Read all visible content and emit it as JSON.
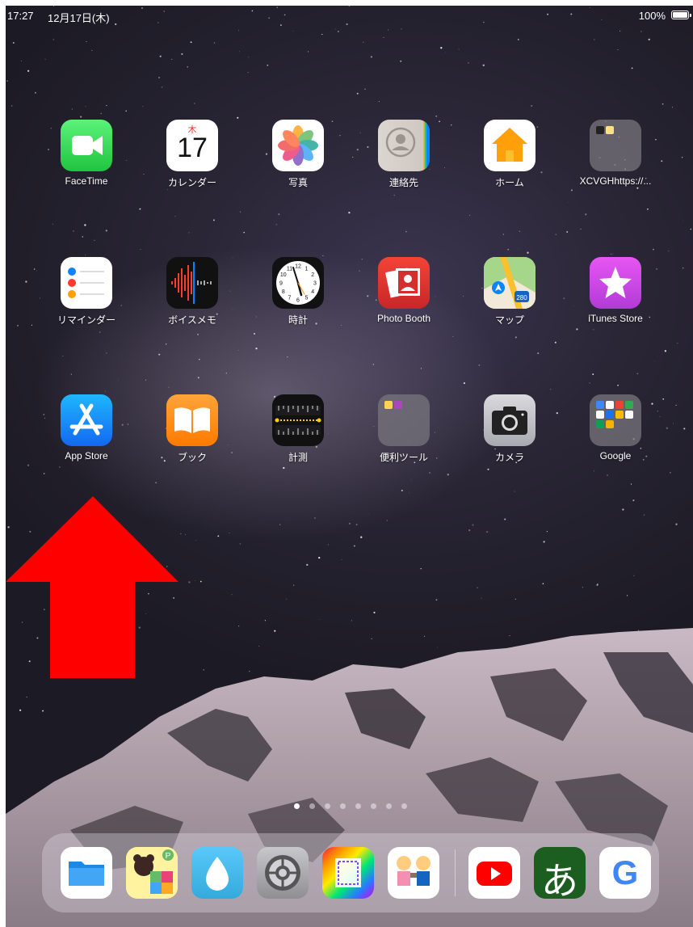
{
  "status_bar": {
    "time": "17:27",
    "date": "12月17日(木)",
    "battery_percent": "100%",
    "battery_level": 1.0
  },
  "apps": [
    {
      "label": "FaceTime",
      "icon": "facetime-icon"
    },
    {
      "label": "カレンダー",
      "icon": "calendar-icon",
      "weekday": "木",
      "day": "17"
    },
    {
      "label": "写真",
      "icon": "photos-icon"
    },
    {
      "label": "連絡先",
      "icon": "contacts-icon"
    },
    {
      "label": "ホーム",
      "icon": "home-app-icon"
    },
    {
      "label": "XCVGHhttps://...",
      "icon": "folder-icon"
    },
    {
      "label": "リマインダー",
      "icon": "reminders-icon"
    },
    {
      "label": "ボイスメモ",
      "icon": "voice-memos-icon"
    },
    {
      "label": "時計",
      "icon": "clock-icon",
      "clock_numbers": [
        "12",
        "1",
        "2",
        "3",
        "4",
        "5",
        "6",
        "7",
        "8",
        "9",
        "10",
        "11"
      ]
    },
    {
      "label": "Photo Booth",
      "icon": "photo-booth-icon"
    },
    {
      "label": "マップ",
      "icon": "maps-icon",
      "road_sign": "280"
    },
    {
      "label": "iTunes Store",
      "icon": "itunes-store-icon"
    },
    {
      "label": "App Store",
      "icon": "app-store-icon"
    },
    {
      "label": "ブック",
      "icon": "books-icon"
    },
    {
      "label": "計測",
      "icon": "measure-icon"
    },
    {
      "label": "便利ツール",
      "icon": "folder-icon"
    },
    {
      "label": "カメラ",
      "icon": "camera-icon"
    },
    {
      "label": "Google",
      "icon": "google-folder-icon"
    }
  ],
  "page_indicator": {
    "count": 8,
    "active_index": 0
  },
  "dock": [
    {
      "icon": "files-icon"
    },
    {
      "icon": "kids-blocks-app-icon",
      "badge": "P"
    },
    {
      "icon": "water-drop-app-icon"
    },
    {
      "icon": "settings-icon"
    },
    {
      "icon": "book-creator-icon"
    },
    {
      "icon": "kids-people-app-icon"
    },
    {
      "icon": "youtube-icon"
    },
    {
      "icon": "hiragana-app-icon",
      "glyph": "あ"
    },
    {
      "icon": "google-icon",
      "glyph": "G"
    }
  ],
  "overlay": {
    "icon": "red-up-arrow",
    "color": "#ff0000"
  }
}
